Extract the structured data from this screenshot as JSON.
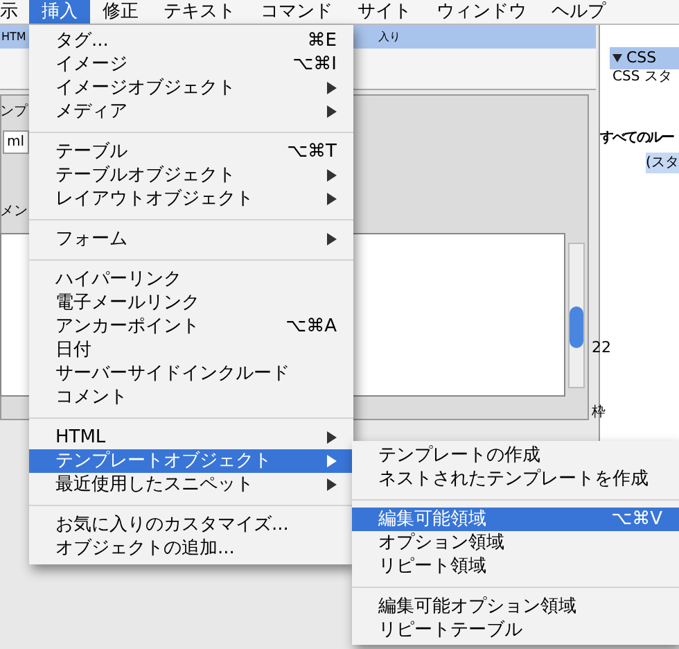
{
  "menubar": [
    {
      "label": "示",
      "selected": false
    },
    {
      "label": "挿入",
      "selected": true
    },
    {
      "label": "修正",
      "selected": false
    },
    {
      "label": "テキスト",
      "selected": false
    },
    {
      "label": "コマンド",
      "selected": false
    },
    {
      "label": "サイト",
      "selected": false
    },
    {
      "label": "ウィンドウ",
      "selected": false
    },
    {
      "label": "ヘルプ",
      "selected": false
    }
  ],
  "background": {
    "panel_tab": "HTM",
    "panel_tab_end": "入り",
    "left_label": "ンプ",
    "doc_tab": "ml",
    "toolbar_label": "メン",
    "css_panel_title": "CSS",
    "css_tab": "CSS スタ",
    "rules_header": "すべてのルー",
    "rules_item": "(スタ",
    "side_number": "22",
    "side_label": "枠"
  },
  "menu": [
    {
      "kind": "item",
      "label": "タグ...",
      "shortcut": "⌘E",
      "submenu": false,
      "selected": false
    },
    {
      "kind": "item",
      "label": "イメージ",
      "shortcut": "⌥⌘I",
      "submenu": false,
      "selected": false
    },
    {
      "kind": "item",
      "label": "イメージオブジェクト",
      "submenu": true,
      "selected": false
    },
    {
      "kind": "item",
      "label": "メディア",
      "submenu": true,
      "selected": false
    },
    {
      "kind": "separator"
    },
    {
      "kind": "item",
      "label": "テーブル",
      "shortcut": "⌥⌘T",
      "submenu": false,
      "selected": false
    },
    {
      "kind": "item",
      "label": "テーブルオブジェクト",
      "submenu": true,
      "selected": false
    },
    {
      "kind": "item",
      "label": "レイアウトオブジェクト",
      "submenu": true,
      "selected": false
    },
    {
      "kind": "separator"
    },
    {
      "kind": "item",
      "label": "フォーム",
      "submenu": true,
      "selected": false
    },
    {
      "kind": "separator"
    },
    {
      "kind": "item",
      "label": "ハイパーリンク",
      "submenu": false,
      "selected": false
    },
    {
      "kind": "item",
      "label": "電子メールリンク",
      "submenu": false,
      "selected": false
    },
    {
      "kind": "item",
      "label": "アンカーポイント",
      "shortcut": "⌥⌘A",
      "submenu": false,
      "selected": false
    },
    {
      "kind": "item",
      "label": "日付",
      "submenu": false,
      "selected": false
    },
    {
      "kind": "item",
      "label": "サーバーサイドインクルード",
      "submenu": false,
      "selected": false
    },
    {
      "kind": "item",
      "label": "コメント",
      "submenu": false,
      "selected": false
    },
    {
      "kind": "separator"
    },
    {
      "kind": "item",
      "label": "HTML",
      "submenu": true,
      "selected": false
    },
    {
      "kind": "item",
      "label": "テンプレートオブジェクト",
      "submenu": true,
      "selected": true
    },
    {
      "kind": "item",
      "label": "最近使用したスニペット",
      "submenu": true,
      "selected": false
    },
    {
      "kind": "separator"
    },
    {
      "kind": "item",
      "label": "お気に入りのカスタマイズ...",
      "submenu": false,
      "selected": false
    },
    {
      "kind": "item",
      "label": "オブジェクトの追加...",
      "submenu": false,
      "selected": false
    }
  ],
  "submenu": [
    {
      "kind": "item",
      "label": "テンプレートの作成",
      "selected": false
    },
    {
      "kind": "item",
      "label": "ネストされたテンプレートを作成",
      "selected": false
    },
    {
      "kind": "separator"
    },
    {
      "kind": "item",
      "label": "編集可能領域",
      "shortcut": "⌥⌘V",
      "selected": true
    },
    {
      "kind": "item",
      "label": "オプション領域",
      "selected": false
    },
    {
      "kind": "item",
      "label": "リピート領域",
      "selected": false
    },
    {
      "kind": "separator"
    },
    {
      "kind": "item",
      "label": "編集可能オプション領域",
      "selected": false
    },
    {
      "kind": "item",
      "label": "リピートテーブル",
      "selected": false
    }
  ]
}
